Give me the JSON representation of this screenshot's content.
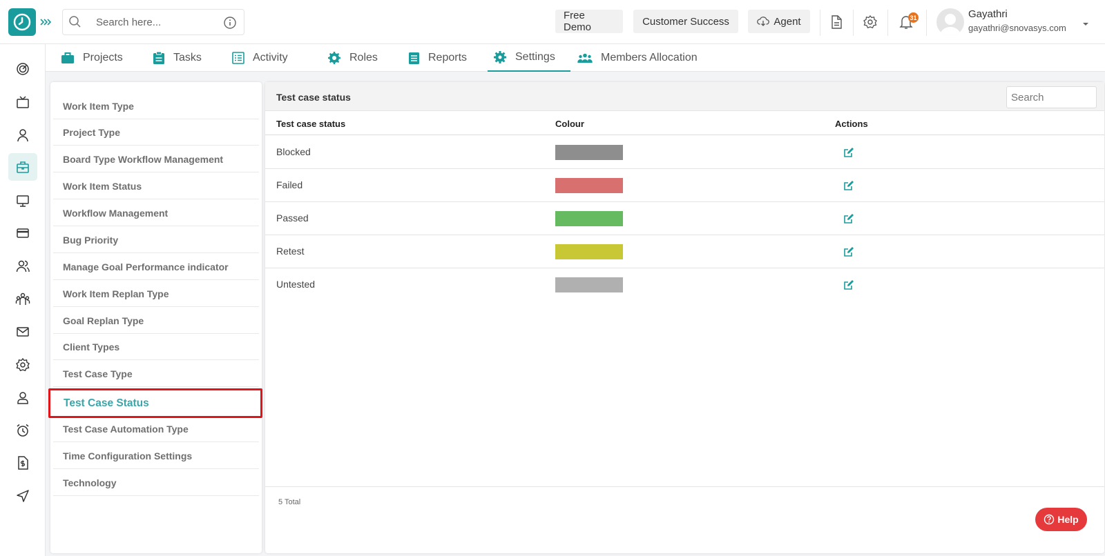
{
  "topbar": {
    "search_placeholder": "Search here...",
    "free_demo": "Free Demo",
    "customer_success": "Customer Success",
    "agent": "Agent",
    "notification_count": "31",
    "user_name": "Gayathri",
    "user_email": "gayathri@snovasys.com"
  },
  "tabs": [
    {
      "label": "Projects",
      "icon": "briefcase-icon"
    },
    {
      "label": "Tasks",
      "icon": "clipboard-icon"
    },
    {
      "label": "Activity",
      "icon": "list-icon"
    },
    {
      "label": "Roles",
      "icon": "roles-gear-icon"
    },
    {
      "label": "Reports",
      "icon": "report-icon"
    },
    {
      "label": "Settings",
      "icon": "settings-gear-icon",
      "active": true
    },
    {
      "label": "Members Allocation",
      "icon": "users-icon"
    }
  ],
  "rail": [
    "dashboard-icon",
    "tv-icon",
    "user-icon",
    "briefcase-icon",
    "monitor-icon",
    "card-icon",
    "users-icon",
    "team-icon",
    "mail-icon",
    "gear-icon",
    "profile-icon",
    "alarm-icon",
    "invoice-icon",
    "send-icon"
  ],
  "settings_menu": [
    "Work Item Type",
    "Project Type",
    "Board Type Workflow Management",
    "Work Item Status",
    "Workflow Management",
    "Bug Priority",
    "Manage Goal Performance indicator",
    "Work Item Replan Type",
    "Goal Replan Type",
    "Client Types",
    "Test Case Type",
    "Test Case Status",
    "Test Case Automation Type",
    "Time Configuration Settings",
    "Technology"
  ],
  "active_menu_index": 11,
  "panel": {
    "title": "Test case status",
    "search_placeholder": "Search",
    "columns": [
      "Test case status",
      "Colour",
      "Actions"
    ],
    "rows": [
      {
        "status": "Blocked",
        "colour": "#8e8e8e"
      },
      {
        "status": "Failed",
        "colour": "#d97070"
      },
      {
        "status": "Passed",
        "colour": "#66bb61"
      },
      {
        "status": "Retest",
        "colour": "#c8c834"
      },
      {
        "status": "Untested",
        "colour": "#b0b0b0"
      }
    ],
    "total": "5 Total"
  },
  "help_label": "Help",
  "colors": {
    "accent": "#1a9c9c",
    "highlight": "#e0151a",
    "help": "#e5393b"
  }
}
